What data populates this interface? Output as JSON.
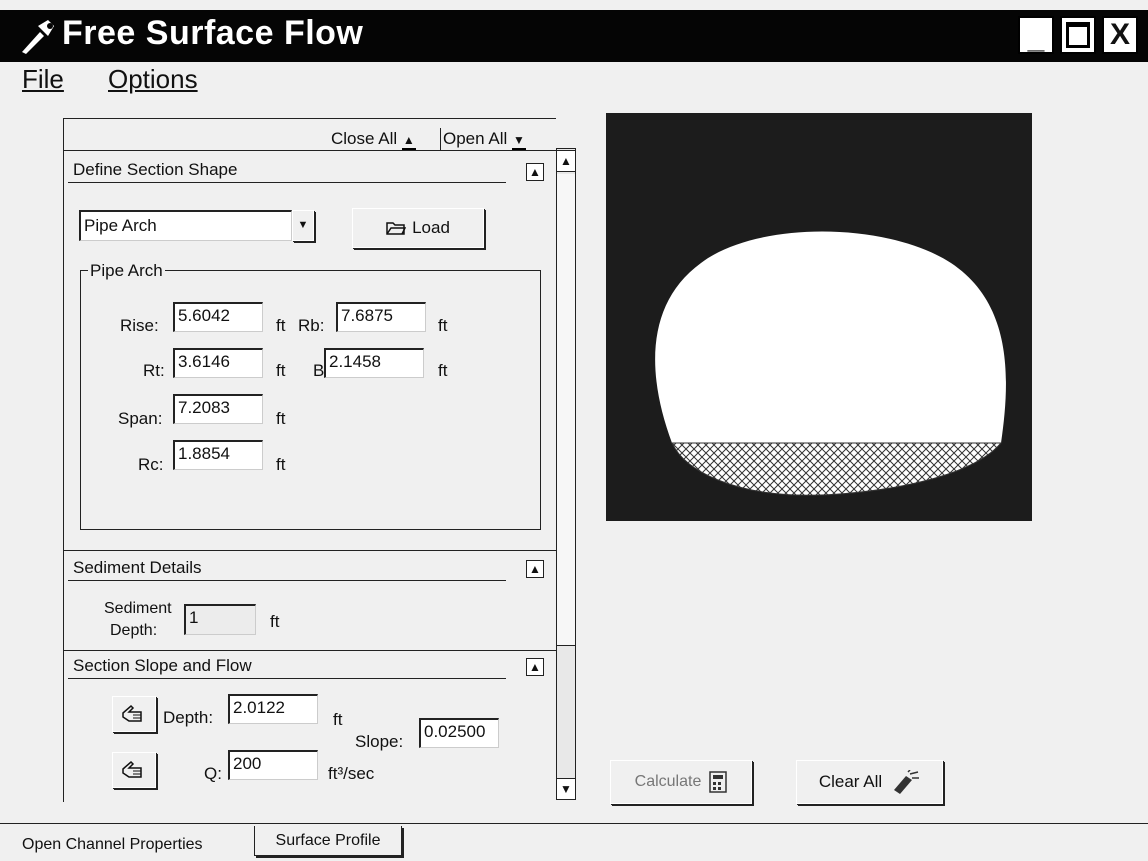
{
  "window": {
    "title": "Free Surface Flow",
    "controls": {
      "minimize": "_",
      "maximize": "□",
      "close": "X"
    }
  },
  "menu": {
    "items": [
      "File",
      "Options"
    ]
  },
  "panel_toolbar": {
    "close_all": "Close All",
    "open_all": "Open All"
  },
  "define_section": {
    "heading": "Define Section Shape",
    "shape_select": "Pipe Arch",
    "load_button": "Load",
    "group_label": "Pipe Arch",
    "fields": {
      "rise": {
        "label": "Rise:",
        "value": "5.6042",
        "unit": "ft"
      },
      "rb": {
        "label": "Rb:",
        "value": "7.6875",
        "unit": "ft"
      },
      "rt": {
        "label": "Rt:",
        "value": "3.6146",
        "unit": "ft"
      },
      "b": {
        "label": "B:",
        "value": "2.1458",
        "unit": "ft"
      },
      "span": {
        "label": "Span:",
        "value": "7.2083",
        "unit": "ft"
      },
      "rc": {
        "label": "Rc:",
        "value": "1.8854",
        "unit": "ft"
      }
    }
  },
  "sediment": {
    "heading": "Sediment Details",
    "depth_label_1": "Sediment",
    "depth_label_2": "Depth:",
    "depth_value": "1",
    "depth_unit": "ft"
  },
  "slope_flow": {
    "heading": "Section Slope and Flow",
    "depth_label": "Depth:",
    "depth_value": "2.0122",
    "depth_unit": "ft",
    "slope_label": "Slope:",
    "slope_value": "0.02500",
    "q_label": "Q:",
    "q_value": "200",
    "q_unit": "ft³/sec"
  },
  "actions": {
    "calculate": "Calculate",
    "clear_all": "Clear All"
  },
  "tabs": [
    "Open Channel Properties",
    "Surface Profile"
  ],
  "colors": {
    "titlebar": "#050505",
    "viewer_bg": "#1c1c1c",
    "section_fill": "#ffffff"
  }
}
